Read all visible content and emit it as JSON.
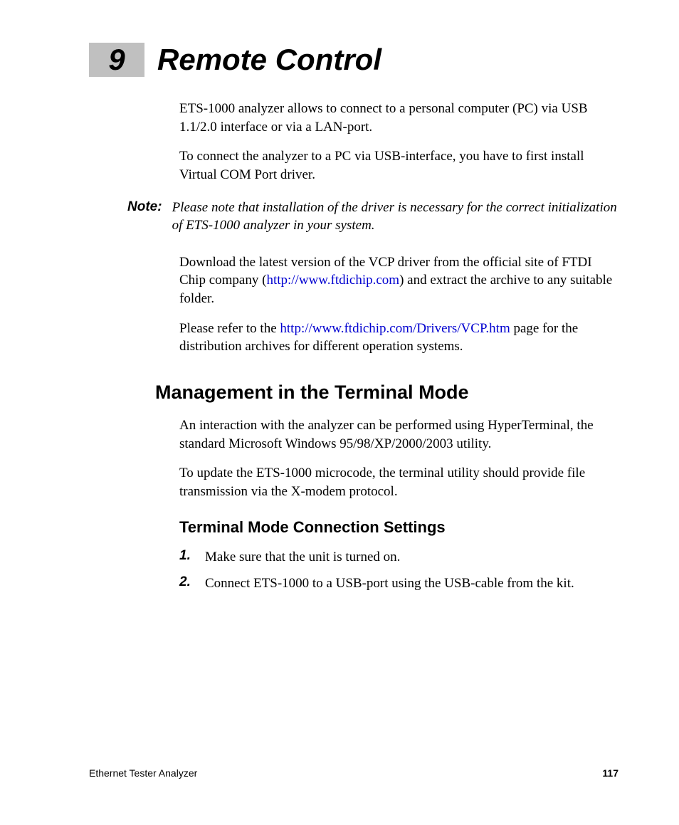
{
  "chapter": {
    "number": "9",
    "title": "Remote Control"
  },
  "intro": {
    "p1": "ETS-1000 analyzer allows to connect to a personal computer (PC) via USB 1.1/2.0 interface or via a LAN-port.",
    "p2": "To connect the analyzer to a PC via USB-interface, you have to first install Virtual COM Port driver."
  },
  "note": {
    "label": "Note:",
    "text": "Please note that installation of the driver is necessary for the correct initialization of ETS-1000 analyzer in your system."
  },
  "download": {
    "pre": "Download the latest version of the VCP driver from the official site of FTDI Chip company (",
    "link1": "http://www.ftdichip.com",
    "post": ") and extract the archive to any suitable folder."
  },
  "refer": {
    "pre": "Please refer to the ",
    "link2": "http://www.ftdichip.com/Drivers/VCP.htm",
    "post": " page for the distribution archives for different operation systems."
  },
  "section2": {
    "title": "Management in the Terminal Mode",
    "p1": "An interaction with the analyzer can be performed using HyperTerminal, the standard Microsoft Windows 95/98/XP/2000/2003 utility.",
    "p2": "To update the ETS-1000 microcode, the terminal utility should provide file transmission via the X-modem protocol."
  },
  "section3": {
    "title": "Terminal Mode Connection Settings",
    "steps": [
      {
        "num": "1.",
        "text": "Make sure that the unit is turned on."
      },
      {
        "num": "2.",
        "text": "Connect ETS-1000 to a USB-port using the USB-cable from the kit."
      }
    ]
  },
  "footer": {
    "left": "Ethernet Tester Analyzer",
    "page": "117"
  }
}
